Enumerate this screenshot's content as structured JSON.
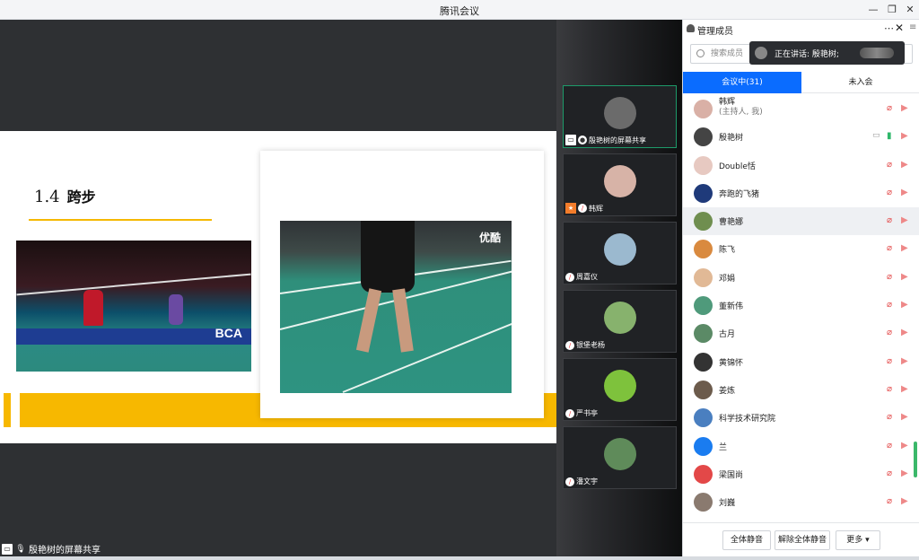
{
  "window": {
    "title": "腾讯会议"
  },
  "slide": {
    "number": "1.4",
    "heading": "跨步",
    "video_watermark": "优酷",
    "left_image_logo": "BCA"
  },
  "share_label": "殷艳树的屏幕共享",
  "gallery": [
    {
      "name": "殷艳树的屏幕共享",
      "avatar_color": "#6b6b6b",
      "active": true,
      "screen": true
    },
    {
      "name": "韩辉",
      "avatar_color": "#d7b3a7",
      "host": true
    },
    {
      "name": "周嘉仪",
      "avatar_color": "#9bb9cf"
    },
    {
      "name": "银堡老杨",
      "avatar_color": "#87b26d"
    },
    {
      "name": "严书亭",
      "avatar_color": "#7ec23c"
    },
    {
      "name": "潘文宇",
      "avatar_color": "#5f8b5a"
    }
  ],
  "panel": {
    "title": "管理成员",
    "search_placeholder": "搜索成员",
    "speaking": "正在讲话: 殷艳树;",
    "tabs": {
      "in_meeting": "会议中(31)",
      "not_joined": "未入会"
    },
    "members": [
      {
        "name": "韩辉",
        "sub": "(主持人, 我)",
        "color": "#d9b0a6"
      },
      {
        "name": "殷艳树",
        "color": "#444",
        "mic_on": true,
        "screen": true
      },
      {
        "name": "Double恬",
        "color": "#e7c9c1"
      },
      {
        "name": "奔跑的飞猪",
        "color": "#1f3a7a"
      },
      {
        "name": "曹艳娜",
        "color": "#6f8e4f",
        "selected": true
      },
      {
        "name": "陈飞",
        "color": "#d98a3f"
      },
      {
        "name": "邓娟",
        "color": "#e1b996"
      },
      {
        "name": "董新伟",
        "color": "#4f9a7b"
      },
      {
        "name": "古月",
        "color": "#5b8a66"
      },
      {
        "name": "黄锦怀",
        "color": "#333"
      },
      {
        "name": "姜炼",
        "color": "#6c5b4c"
      },
      {
        "name": "科学技术研究院",
        "color": "#4a7fc0"
      },
      {
        "name": "兰",
        "color": "#1a7cf0"
      },
      {
        "name": "梁国尚",
        "color": "#e34848"
      },
      {
        "name": "刘巍",
        "color": "#8a7a6f"
      }
    ],
    "footer": {
      "mute_all": "全体静音",
      "unmute_all": "解除全体静音",
      "more": "更多 ▾"
    }
  }
}
